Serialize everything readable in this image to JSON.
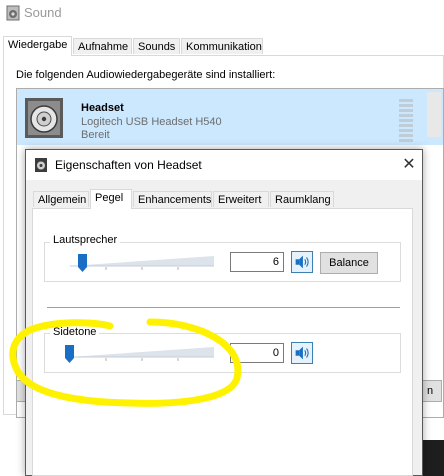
{
  "sound_window": {
    "title": "Sound",
    "tabs": [
      "Wiedergabe",
      "Aufnahme",
      "Sounds",
      "Kommunikation"
    ],
    "active_tab": "Wiedergabe",
    "installed_text": "Die folgenden Audiowiedergabegeräte sind installiert:",
    "device": {
      "name": "Headset",
      "model": "Logitech USB Headset H540",
      "status": "Bereit"
    }
  },
  "props_window": {
    "title": "Eigenschaften von Headset",
    "close_glyph": "✕",
    "tabs": [
      "Allgemein",
      "Pegel",
      "Enhancements",
      "Erweitert",
      "Raumklang"
    ],
    "active_tab": "Pegel",
    "speaker": {
      "label": "Lautsprecher",
      "value": "6",
      "level_fraction": 0.06,
      "balance_label": "Balance"
    },
    "sidetone": {
      "label": "Sidetone",
      "value": "0",
      "level_fraction": 0.0
    }
  },
  "colors": {
    "selection": "#cce8ff",
    "highlight_annotation": "#fff200",
    "slider_thumb": "#1a6fc4"
  },
  "icons": {
    "window": "speaker-window-icon",
    "device": "speaker-device-icon",
    "mute": "speaker-volume-icon",
    "close": "close-icon"
  }
}
